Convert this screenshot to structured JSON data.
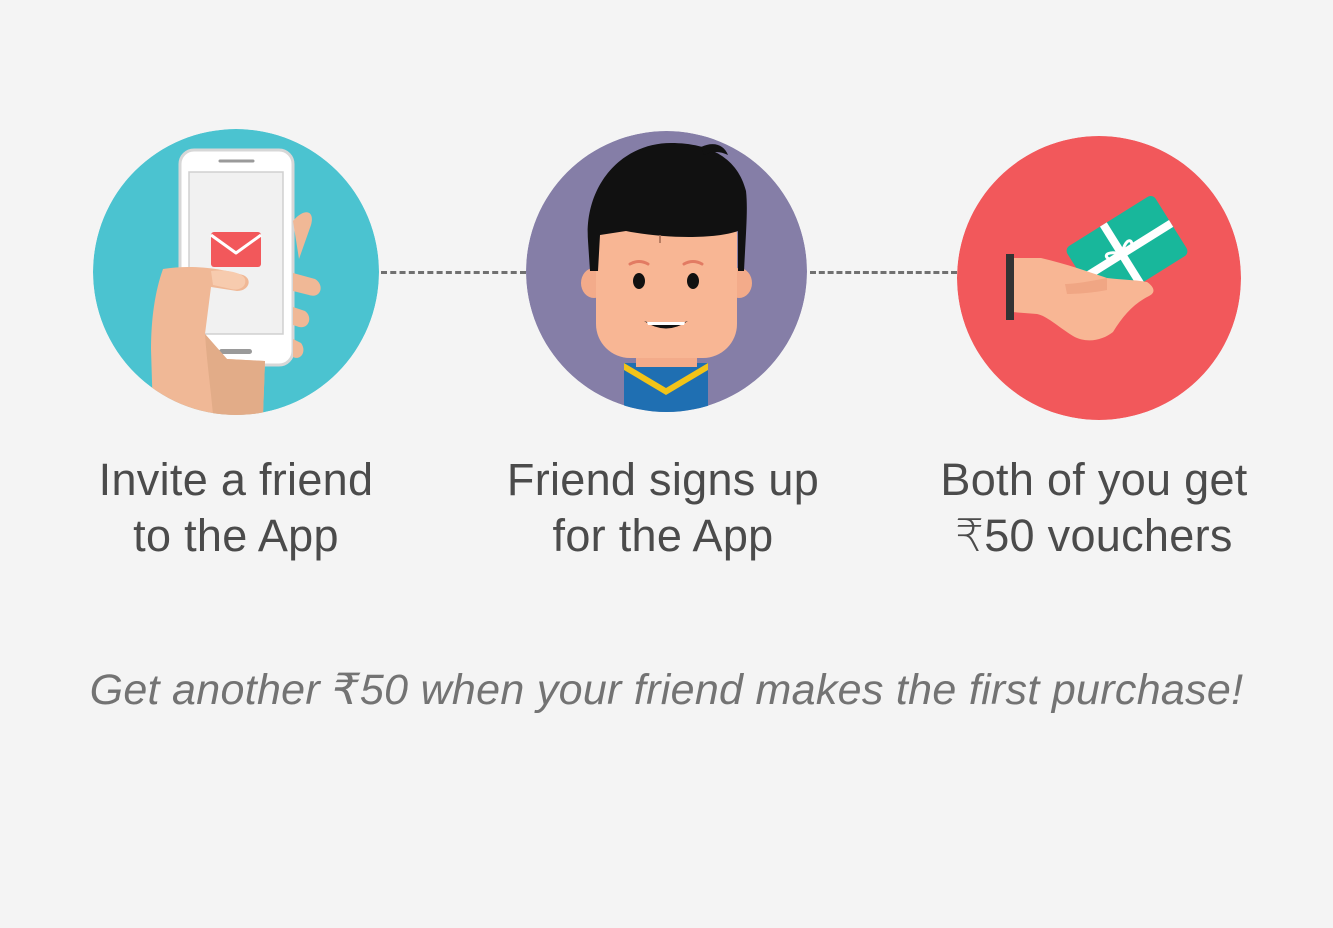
{
  "steps": [
    {
      "icon": "phone-invite-icon",
      "line1": "Invite a friend",
      "line2": "to the App",
      "circle_color": "#4bc3d0"
    },
    {
      "icon": "friend-avatar-icon",
      "line1": "Friend signs up",
      "line2": "for the App",
      "circle_color": "#857ea7"
    },
    {
      "icon": "gift-voucher-hand-icon",
      "line1": "Both of you get",
      "line2": "₹50 vouchers",
      "circle_color": "#f2585b"
    }
  ],
  "bonus_note": "Get another ₹50 when your friend makes the first purchase!",
  "colors": {
    "background": "#f4f4f4",
    "connector": "#707070",
    "text": "#4b4b4b",
    "note_text": "#737373"
  }
}
